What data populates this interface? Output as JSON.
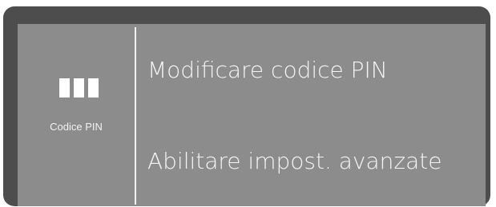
{
  "sidebar": {
    "icon": "pin-icon",
    "label": "Codice PIN"
  },
  "menu": {
    "items": [
      {
        "label": "Modificare codice PIN"
      },
      {
        "label": "Abilitare impost. avanzate"
      }
    ]
  },
  "colors": {
    "frame": "#4d4d4d",
    "screen": "#8c8c8c",
    "text": "#f4f4f4"
  }
}
